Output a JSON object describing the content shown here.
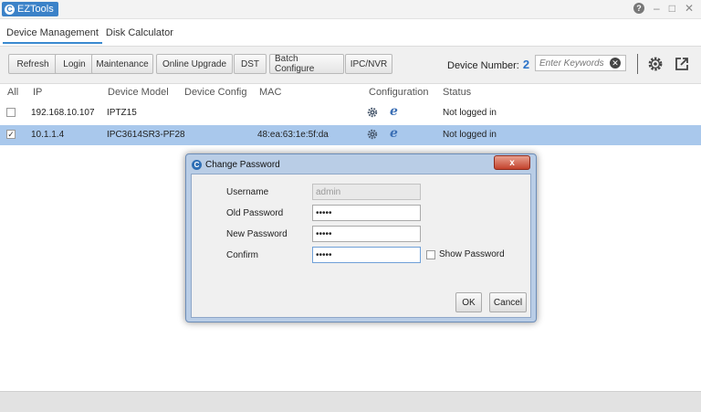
{
  "app": {
    "title": "EZTools",
    "logo_letter": "C"
  },
  "window_controls": {
    "help": "?",
    "minimize": "–",
    "maximize": "□",
    "close": "✕"
  },
  "tabs": [
    {
      "label": "Device Management",
      "active": true
    },
    {
      "label": "Disk Calculator",
      "active": false
    }
  ],
  "toolbar": {
    "buttons": [
      "Refresh",
      "Login",
      "Maintenance",
      "Online Upgrade",
      "DST",
      "Batch Configure",
      "IPC/NVR"
    ],
    "device_number_label": "Device Number:",
    "device_number": "2",
    "search_placeholder": "Enter Keywords",
    "icons": [
      "settings-icon",
      "export-icon"
    ]
  },
  "table": {
    "columns": [
      "All",
      "IP",
      "Device Model",
      "Device Config",
      "MAC",
      "Configuration",
      "Status"
    ],
    "rows": [
      {
        "checked": false,
        "ip": "192.168.10.107",
        "model": "IPTZ15",
        "mac": "",
        "status": "Not logged in",
        "selected": false
      },
      {
        "checked": true,
        "ip": "10.1.1.4",
        "model": "IPC3614SR3-PF28",
        "mac": "48:ea:63:1e:5f:da",
        "status": "Not logged in",
        "selected": true
      }
    ]
  },
  "dialog": {
    "title": "Change Password",
    "close": "x",
    "username_label": "Username",
    "username_value": "admin",
    "old_password_label": "Old Password",
    "old_password_value": "•••••",
    "new_password_label": "New Password",
    "new_password_value": "•••••",
    "confirm_label": "Confirm",
    "confirm_value": "•••••",
    "show_password_label": "Show Password",
    "ok_label": "OK",
    "cancel_label": "Cancel"
  },
  "colors": {
    "accent": "#3b82c8",
    "selection": "#a9c8ec",
    "device_number": "#2a72c8"
  }
}
